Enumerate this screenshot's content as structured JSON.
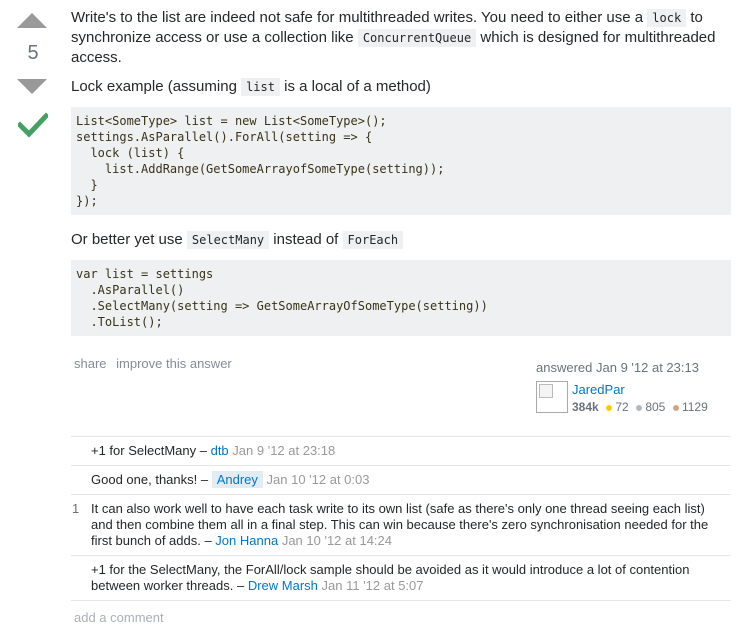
{
  "vote": {
    "count": "5"
  },
  "answer": {
    "para1": {
      "t1": "Write's to the list are indeed not safe for multithreaded writes. You need to either use a ",
      "c1": "lock",
      "t2": " to synchronize access or use a collection like ",
      "c2": "ConcurrentQueue",
      "t3": " which is designed for multithreaded access."
    },
    "para2": {
      "t1": "Lock example (assuming ",
      "c1": "list",
      "t2": " is a local of a method)"
    },
    "code1": [
      "List<SomeType> list = new List<SomeType>();",
      "settings.AsParallel().ForAll(setting => {",
      "  lock (list) {",
      "    list.AddRange(GetSomeArrayofSomeType(setting));",
      "  }",
      "});"
    ],
    "para3": {
      "t1": "Or better yet use ",
      "c1": "SelectMany",
      "t2": " instead of ",
      "c2": "ForEach"
    },
    "code2": [
      "var list = settings",
      "  .AsParallel()",
      "  .SelectMany(setting => GetSomeArrayOfSomeType(setting))",
      "  .ToList();"
    ]
  },
  "menu": {
    "share": "share",
    "improve": "improve this answer"
  },
  "signature": {
    "action": "answered",
    "time": "Jan 9 '12 at 23:13",
    "user": "JaredPar",
    "rep": "384k",
    "gold": "72",
    "silver": "805",
    "bronze": "1129",
    "colors": {
      "gold": "#ffcc01",
      "silver": "#b4b8bc",
      "bronze": "#d1a684"
    }
  },
  "comments": [
    {
      "score": "",
      "text": "+1 for SelectMany – ",
      "user": "dtb",
      "date": "Jan 9 '12 at 23:18",
      "owner": false
    },
    {
      "score": "",
      "text": "Good one, thanks! – ",
      "user": "Andrey",
      "date": "Jan 10 '12 at 0:03",
      "owner": true
    },
    {
      "score": "1",
      "text": "It can also work well to have each task write to its own list (safe as there's only one thread seeing each list) and then combine them all in a final step. This can win because there's zero synchronisation needed for the first bunch of adds. – ",
      "user": "Jon Hanna",
      "date": "Jan 10 '12 at 14:24",
      "owner": false
    },
    {
      "score": "",
      "text": "+1 for the SelectMany, the ForAll/lock sample should be avoided as it would introduce a lot of contention between worker threads. – ",
      "user": "Drew Marsh",
      "date": "Jan 11 '12 at 5:07",
      "owner": false
    }
  ],
  "add_comment": "add a comment",
  "colors": {
    "accent": "#0077cc",
    "accepted": "#45a163",
    "vote_arrow": "#999999"
  }
}
